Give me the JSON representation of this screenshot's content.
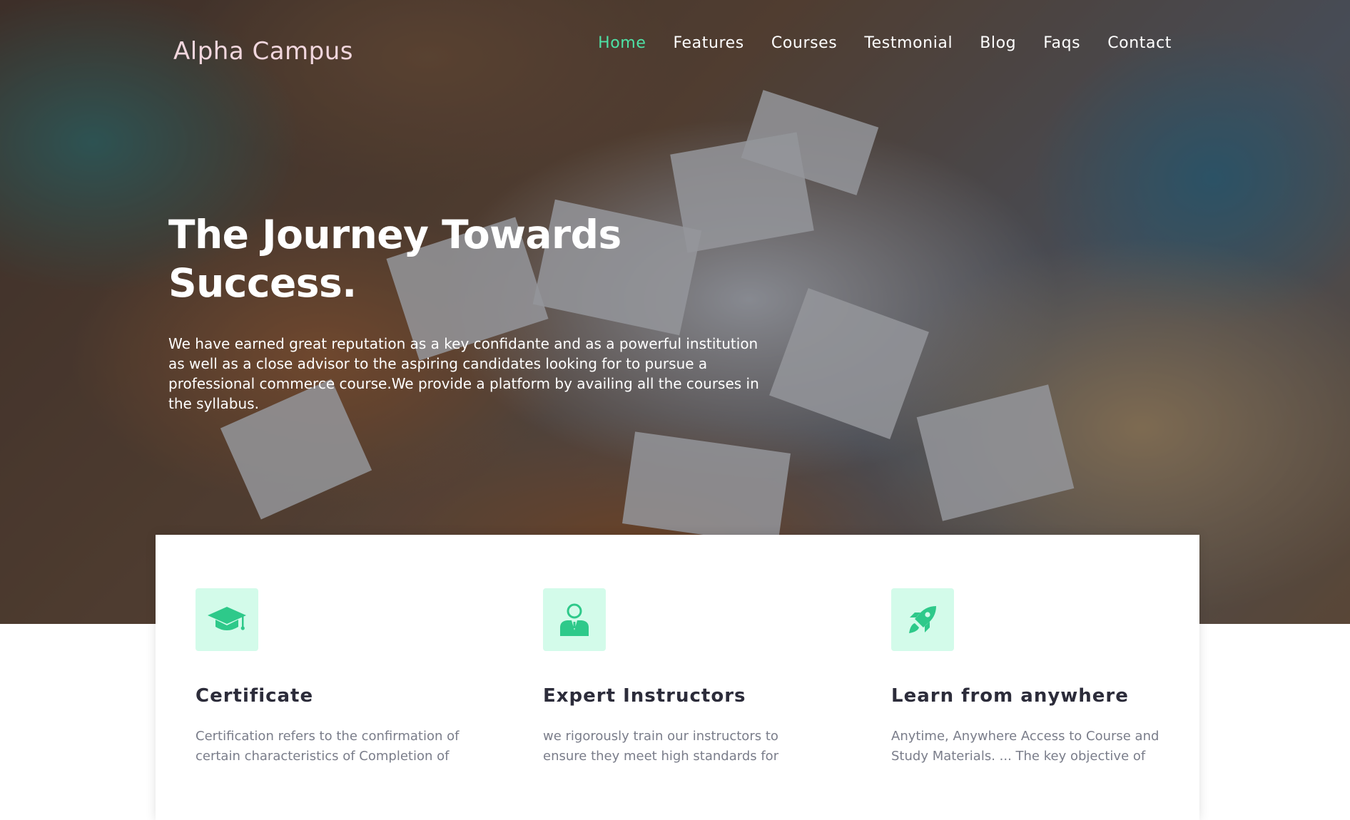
{
  "brand": {
    "name": "Alpha Campus"
  },
  "nav": {
    "items": [
      {
        "label": "Home",
        "active": true
      },
      {
        "label": "Features"
      },
      {
        "label": "Courses"
      },
      {
        "label": "Testmonial"
      },
      {
        "label": "Blog"
      },
      {
        "label": "Faqs"
      },
      {
        "label": "Contact"
      }
    ]
  },
  "hero": {
    "title": "The Journey Towards Success.",
    "text": "We have earned great reputation as a key confidante and as a powerful institution as well as a close advisor to the aspiring candidates looking for to pursue a professional commerce course.We provide a platform by availing all the courses in the syllabus."
  },
  "features": [
    {
      "icon": "graduation-cap-icon",
      "title": "Certificate",
      "text": "Certification refers to the confirmation of certain characteristics of Completion of"
    },
    {
      "icon": "instructor-icon",
      "title": "Expert Instructors",
      "text": "we rigorously train our instructors to ensure they meet high standards for"
    },
    {
      "icon": "rocket-icon",
      "title": "Learn from anywhere",
      "text": "Anytime, Anywhere Access to Course and Study Materials. ... The key objective of"
    }
  ],
  "colors": {
    "accent": "#4ee2a6",
    "icon_bg": "#d3fbea",
    "icon_fg": "#2ec98a",
    "heading": "#2c2c3a",
    "body_text": "#7a7d8a"
  }
}
